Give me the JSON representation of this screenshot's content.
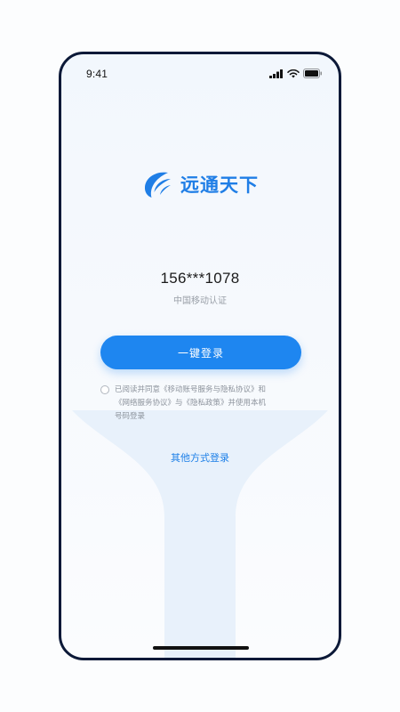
{
  "status_bar": {
    "time": "9:41",
    "icons": [
      "signal-icon",
      "wifi-icon",
      "battery-icon"
    ]
  },
  "brand": {
    "name": "远通天下",
    "logo_icon": "brand-wave-logo-icon",
    "color": "#1f7ee6"
  },
  "login": {
    "phone_number": "156***1078",
    "carrier_text": "中国移动认证",
    "one_click_button": "一键登录",
    "button_color": "#1e86f0",
    "agreement_checked": false,
    "agreement_lines": [
      "已阅读并同意《移动账号服务与隐私协议》和",
      "《网络服务协议》与《隐私政策》并使用本机",
      "号码登录"
    ],
    "other_methods": "其他方式登录"
  }
}
